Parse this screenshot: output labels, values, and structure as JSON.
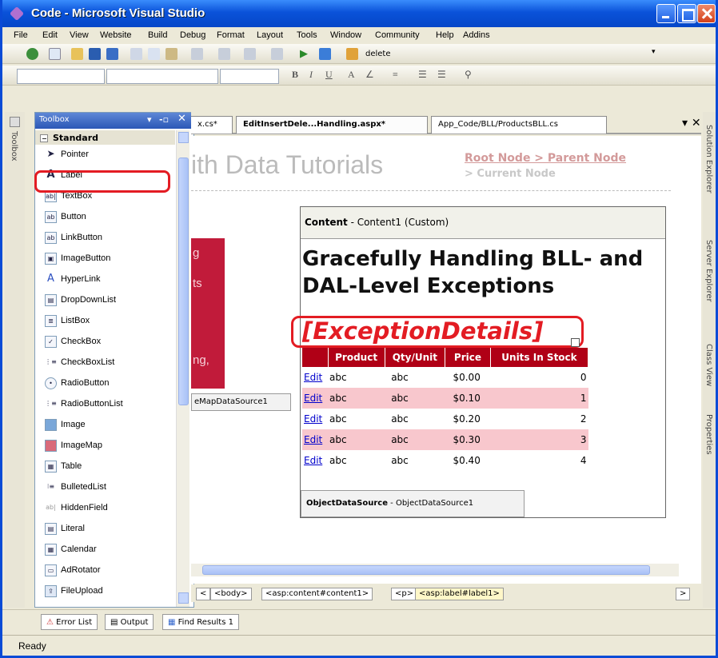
{
  "window": {
    "title": "Code - Microsoft Visual Studio"
  },
  "menu": [
    "File",
    "Edit",
    "View",
    "Website",
    "Build",
    "Debug",
    "Format",
    "Layout",
    "Tools",
    "Window",
    "Community",
    "Help",
    "Addins"
  ],
  "toolbar": {
    "find_text": "delete"
  },
  "toolbox": {
    "title": "Toolbox",
    "group": "Standard",
    "items": [
      "Pointer",
      "Label",
      "TextBox",
      "Button",
      "LinkButton",
      "ImageButton",
      "HyperLink",
      "DropDownList",
      "ListBox",
      "CheckBox",
      "CheckBoxList",
      "RadioButton",
      "RadioButtonList",
      "Image",
      "ImageMap",
      "Table",
      "BulletedList",
      "HiddenField",
      "Literal",
      "Calendar",
      "AdRotator",
      "FileUpload"
    ],
    "selected": "Label"
  },
  "left_dock_label": "Toolbox",
  "doc_tabs": [
    "x.cs*",
    "EditInsertDele...Handling.aspx*",
    "App_Code/BLL/ProductsBLL.cs"
  ],
  "editor": {
    "bg_title": "ith Data Tutorials",
    "breadcrumb_links": "Root Node > Parent Node",
    "breadcrumb_current": "> Current Node",
    "side_menu": [
      "g",
      "ts",
      "ng,"
    ],
    "sitemap_source": "eMapDataSource1",
    "content_header_bold": "Content",
    "content_header_rest": " - Content1 (Custom)",
    "heading": "Gracefully Handling BLL- and DAL-Level Exceptions",
    "exception_label": "[ExceptionDetails]",
    "grid": {
      "headers": [
        "",
        "Product",
        "Qty/Unit",
        "Price",
        "Units In Stock"
      ],
      "rows": [
        [
          "Edit",
          "abc",
          "abc",
          "$0.00",
          "0"
        ],
        [
          "Edit",
          "abc",
          "abc",
          "$0.10",
          "1"
        ],
        [
          "Edit",
          "abc",
          "abc",
          "$0.20",
          "2"
        ],
        [
          "Edit",
          "abc",
          "abc",
          "$0.30",
          "3"
        ],
        [
          "Edit",
          "abc",
          "abc",
          "$0.40",
          "4"
        ]
      ]
    },
    "ods_bold": "ObjectDataSource",
    "ods_rest": " - ObjectDataSource1"
  },
  "tag_bar": [
    "<body>",
    "<asp:content#content1>",
    "<p>",
    "<asp:label#label1>"
  ],
  "right_dock": [
    "Solution Explorer",
    "Server Explorer",
    "Class View",
    "Properties"
  ],
  "bottom_tabs": [
    "Error List",
    "Output",
    "Find Results 1"
  ],
  "status": "Ready",
  "colors": {
    "title_blue": "#0a52d9",
    "grid_header": "#b00016",
    "grid_alt_row": "#f8c7cd",
    "highlight_red": "#e31c23"
  }
}
